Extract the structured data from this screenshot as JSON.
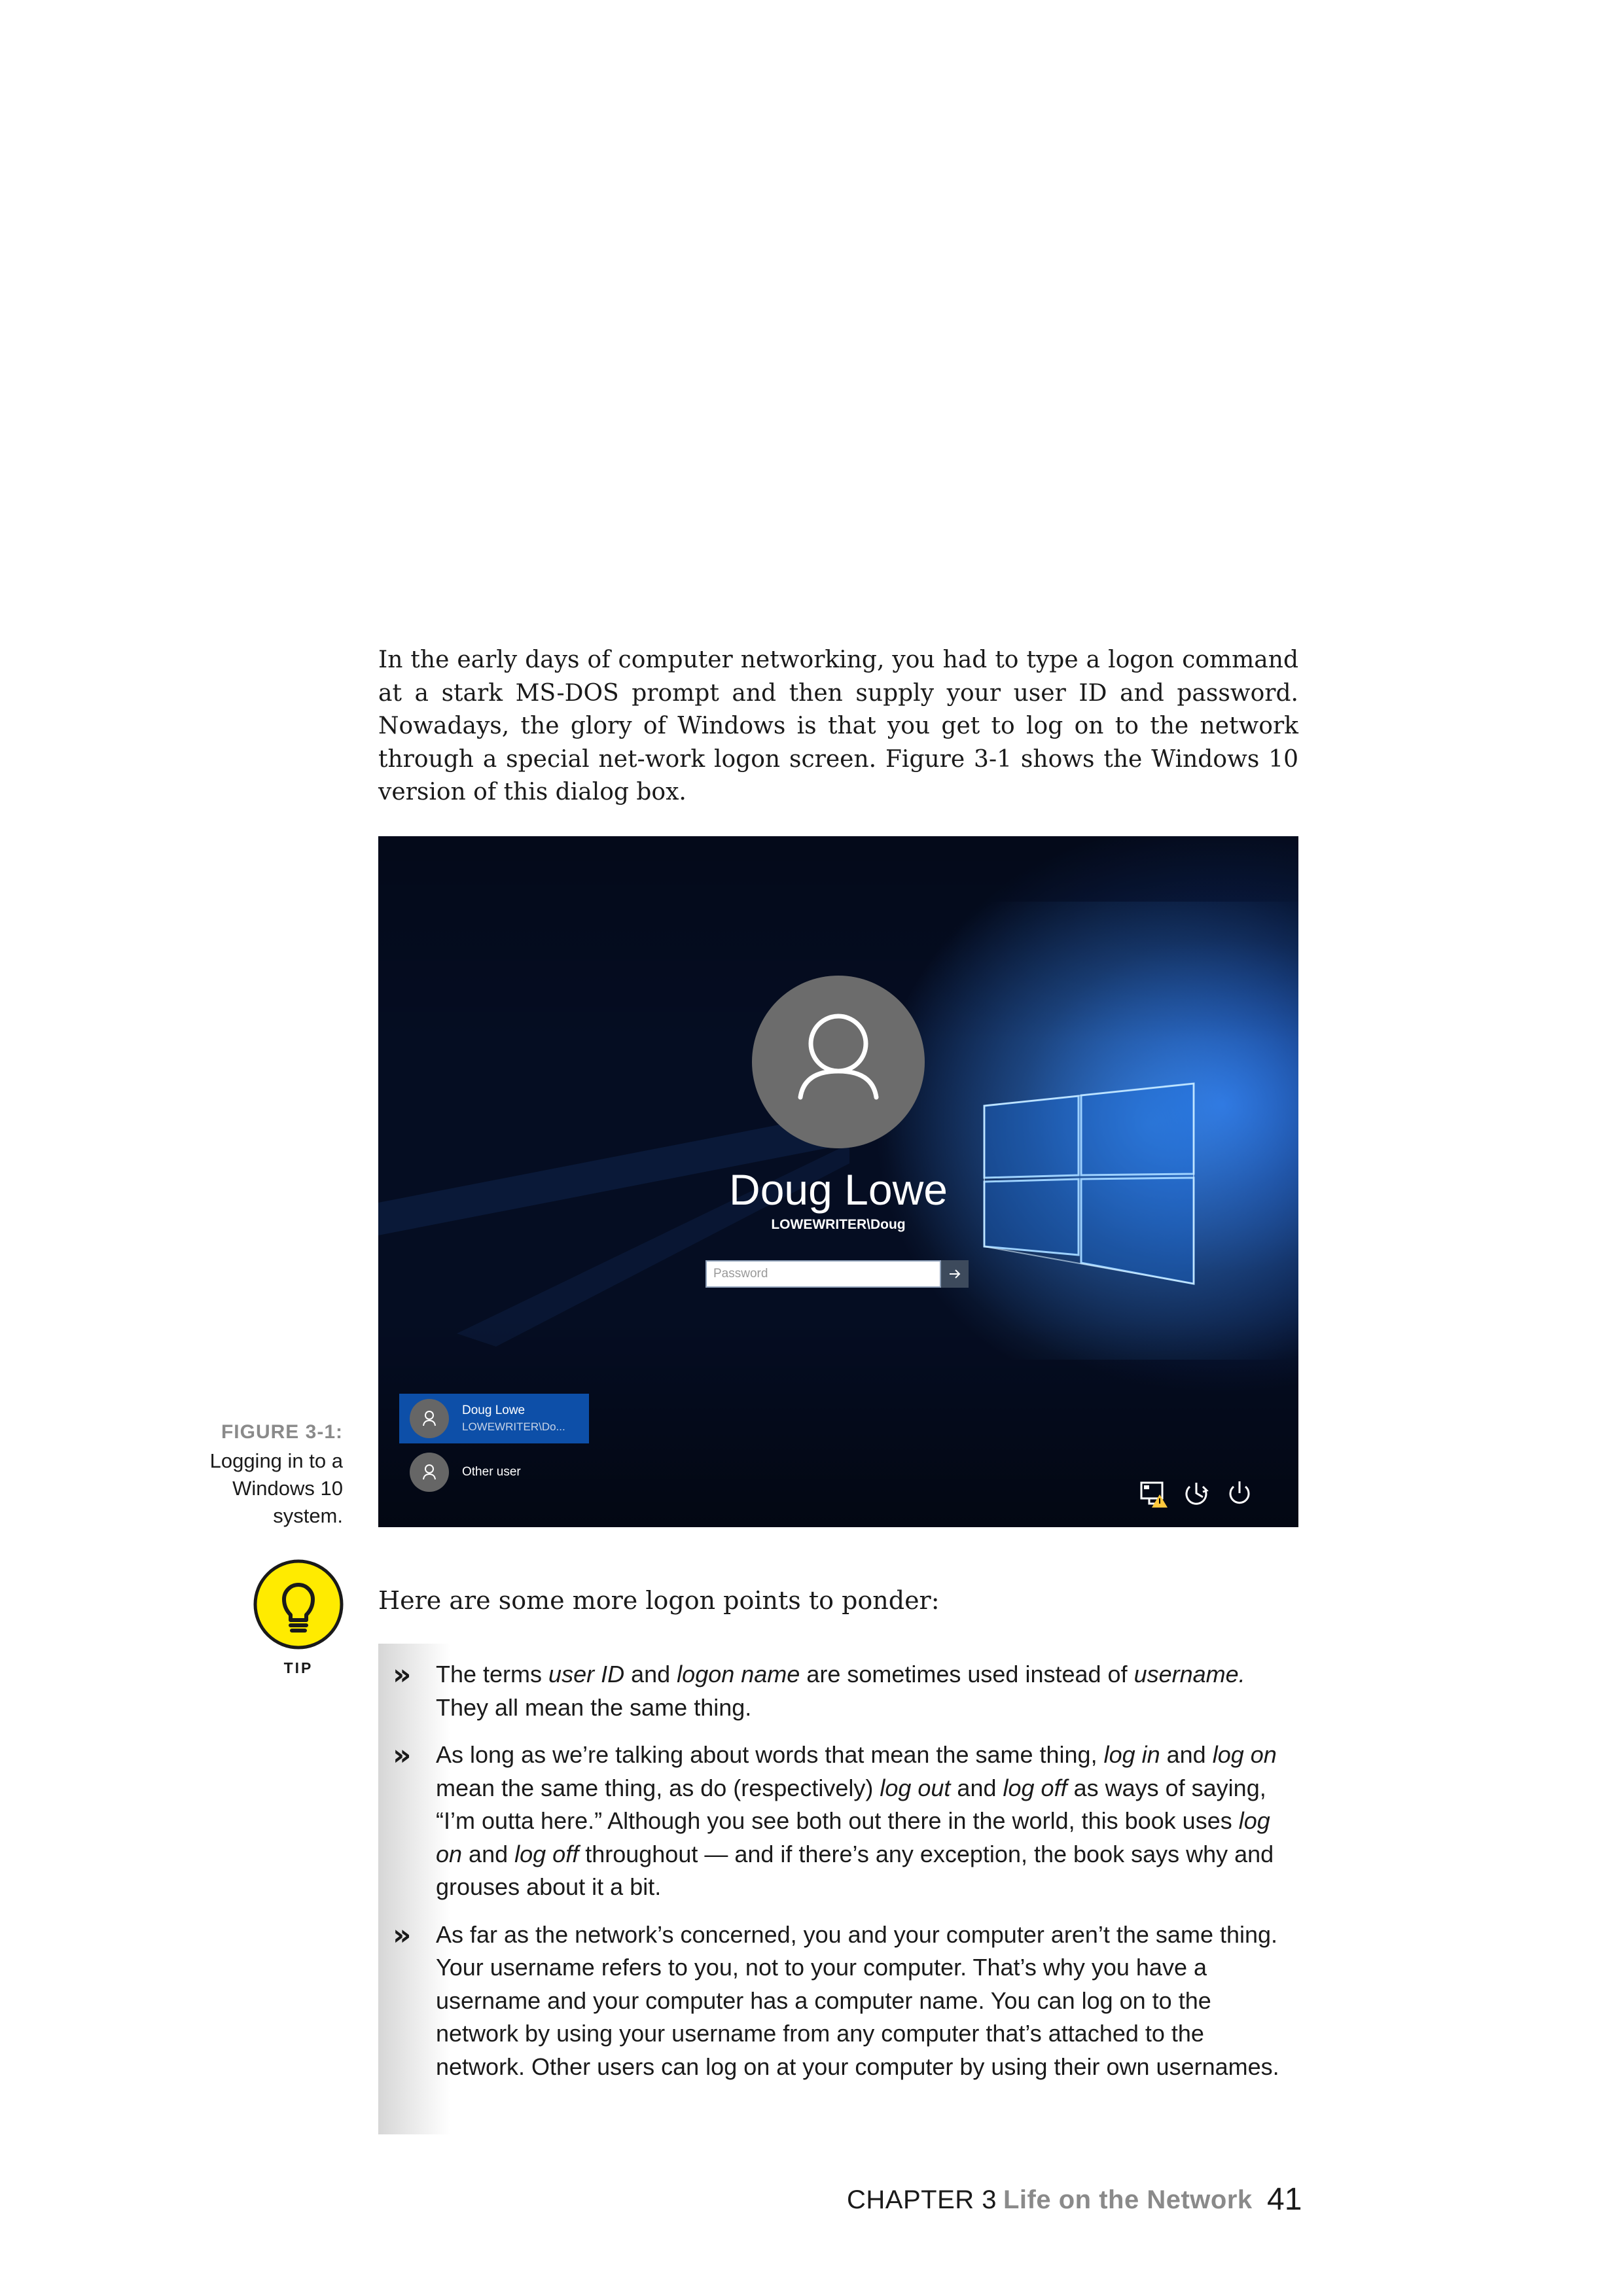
{
  "intro_paragraph": "In the early days of computer networking, you had to type a logon command at a stark MS-DOS prompt and then supply your user ID and password. Nowadays, the glory of Windows is that you get to log on to the network through a special net-work logon screen. Figure 3-1 shows the Windows 10 version of this dialog box.",
  "figure": {
    "label": "FIGURE 3-1:",
    "caption": "Logging in to a Windows 10 system.",
    "screen": {
      "user_name": "Doug Lowe",
      "user_domain": "LOWEWRITER\\Doug",
      "password_placeholder": "Password",
      "user_tiles": [
        {
          "name": "Doug Lowe",
          "sub": "LOWEWRITER\\Do..."
        },
        {
          "name": "Other user"
        }
      ],
      "system_icons": [
        "network-warning-icon",
        "ease-of-access-icon",
        "power-icon"
      ],
      "colors": {
        "accent": "#0d4fa8",
        "background": "#0b2150",
        "avatar": "#6c6c6c"
      }
    }
  },
  "tip": {
    "label": "TIP",
    "icon": "lightbulb-icon",
    "color": "#ffeb00"
  },
  "lead": "Here are some more logon points to ponder:",
  "bullets": {
    "b1": {
      "t1": "The terms ",
      "e1": "user ID",
      "t2": " and ",
      "e2": "logon name",
      "t3": " are sometimes used instead of ",
      "e3": "username.",
      "t4": " They all mean the same thing."
    },
    "b2": {
      "t1": "As long as we’re talking about words that mean the same thing, ",
      "e1": "log in",
      "t2": " and ",
      "e2": "log on",
      "t3": " mean the same thing, as do (respectively) ",
      "e3": "log out",
      "t4": " and ",
      "e4": "log off",
      "t5": " as ways of saying, “I’m outta here.” Although you see both out there in the world, this book uses ",
      "e5": "log on",
      "t6": " and ",
      "e6": "log off",
      "t7": " throughout — and if there’s any exception, the book says why and grouses about it a bit."
    },
    "b3": {
      "t1": "As far as the network’s concerned, you and your computer aren’t the same thing. Your username refers to you, not to your computer. That’s why you have a username and your computer has a computer name. You can log on to the network by using your username from any computer that’s attached to the network. Other users can log on at your computer by using their own usernames."
    },
    "marker": "»"
  },
  "footer": {
    "chapter": "CHAPTER 3",
    "title": "Life on the Network",
    "page": "41"
  }
}
